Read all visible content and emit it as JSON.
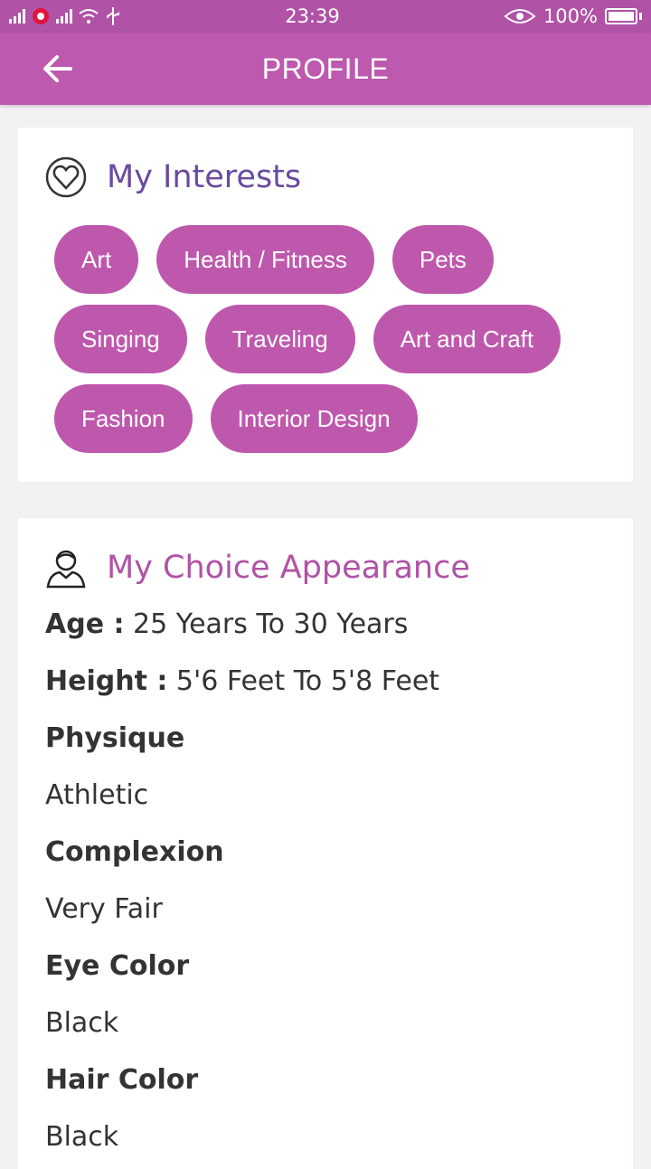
{
  "status_bar": {
    "time": "23:39",
    "battery": "100%"
  },
  "app_bar": {
    "title": "PROFILE"
  },
  "interests": {
    "title": "My Interests",
    "items": [
      "Art",
      "Health / Fitness",
      "Pets",
      "Singing",
      "Traveling",
      "Art and Craft",
      "Fashion",
      "Interior Design"
    ]
  },
  "appearance": {
    "title": "My Choice Appearance",
    "age_label": "Age :",
    "age_value": "25 Years To 30 Years",
    "height_label": "Height :",
    "height_value": "5'6 Feet To 5'8 Feet",
    "physique_label": "Physique",
    "physique_value": "Athletic",
    "complexion_label": "Complexion",
    "complexion_value": "Very Fair",
    "eye_label": "Eye Color",
    "eye_value": "Black",
    "hair_label": "Hair Color",
    "hair_value": "Black"
  },
  "colors": {
    "status_bar": "#b052a6",
    "app_bar": "#bd59ae",
    "chip": "#be58ad",
    "interests_title": "#6a4aa0",
    "appearance_title": "#b052a6"
  },
  "icons": [
    "signal-icon",
    "wifi-icon",
    "usb-icon",
    "eye-icon",
    "battery-icon",
    "back-arrow-icon",
    "heart-circle-icon",
    "person-icon"
  ]
}
